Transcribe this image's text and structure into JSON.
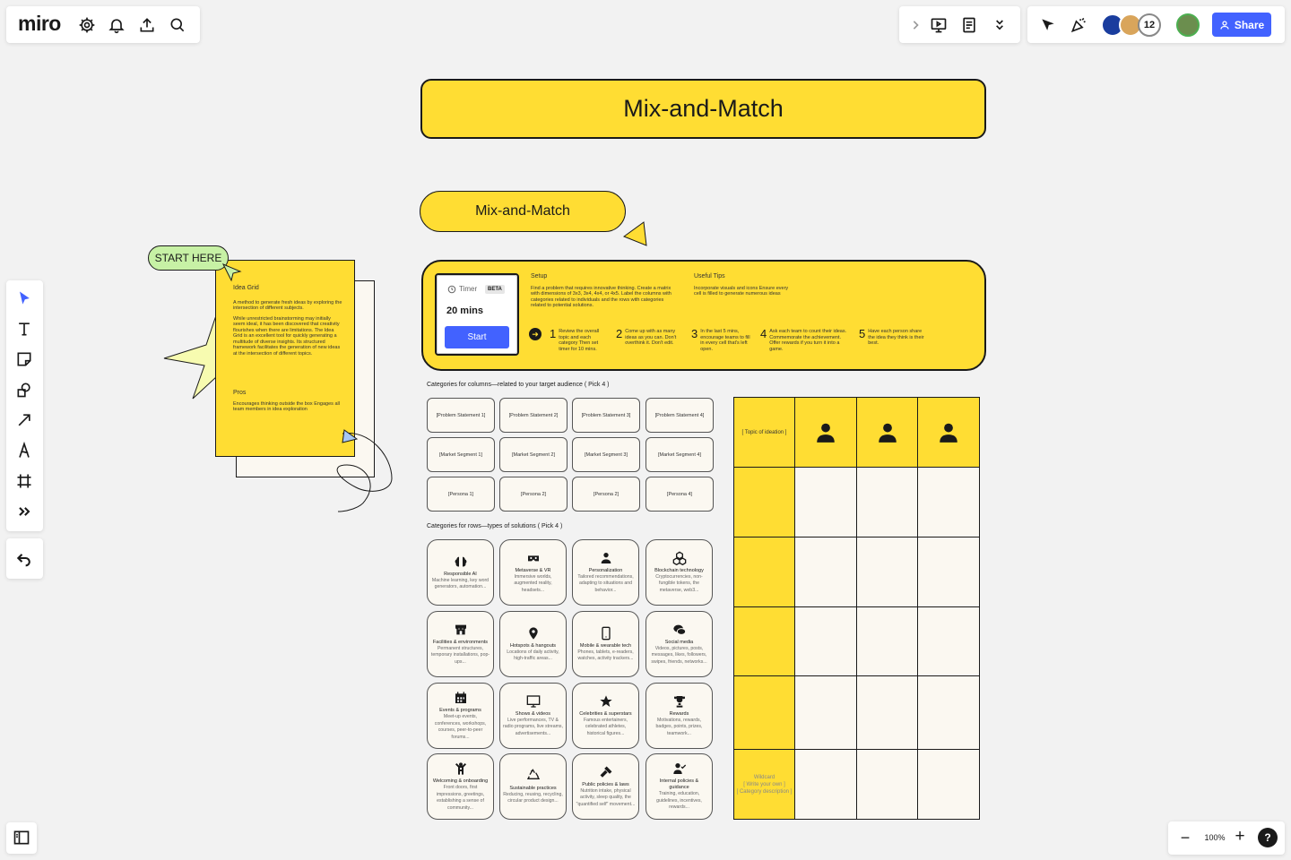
{
  "app": {
    "logo": "miro"
  },
  "top_right": {
    "collaborator_count": "12",
    "share_label": "Share"
  },
  "board": {
    "title": "Mix-and-Match",
    "subtitle": "Mix-and-Match",
    "start_here": "START HERE",
    "idea_card": {
      "heading": "Idea Grid",
      "p1": "A method to generate fresh ideas by exploring the intersection of different subjects.",
      "p2": "While unrestricted brainstorming may initially seem ideal, it has been discovered that creativity flourishes when there are limitations. The Idea Grid is an excellent tool for quickly generating a multitude of diverse insights. Its structured framework facilitates the generation of new ideas at the intersection of different topics.",
      "pros_heading": "Pros",
      "pros_text": "Encourages thinking outside the box Engages all team members in idea exploration"
    },
    "timer": {
      "label": "Timer",
      "badge": "BETA",
      "value": "20 mins",
      "start": "Start"
    },
    "setup": {
      "heading": "Setup",
      "text": "Find a problem that requires innovative thinking. Create a matrix with dimensions of 3x3, 3x4, 4x4, or 4x5. Label the columns with categories related to individuals and the rows with categories related to potential solutions."
    },
    "tips": {
      "heading": "Useful Tips",
      "text": "Incorporate visuals and icons Ensure every cell is filled to generate numerous ideas"
    },
    "steps": [
      {
        "n": "1",
        "text": "Review the overall topic and each category Then set timer for 10 mins."
      },
      {
        "n": "2",
        "text": "Come up with as many ideas as you can. Don't overthink it. Don't edit."
      },
      {
        "n": "3",
        "text": "In the last 5 mins, encourage teams to fill in every cell that's left open."
      },
      {
        "n": "4",
        "text": "Ask each team to count their ideas. Commemorate the achievement. Offer rewards if you turn it into a game."
      },
      {
        "n": "5",
        "text": "Have each person share the idea they think is their best."
      }
    ],
    "columns_heading": "Categories for columns—related to your target audience ( Pick 4 )",
    "column_cards": [
      [
        "[Problem Statement 1]",
        "[Problem Statement 2]",
        "[Problem Statement 3]",
        "[Problem Statement 4]"
      ],
      [
        "[Market Segment 1]",
        "[Market Segment 2]",
        "[Market Segment 3]",
        "[Market Segment 4]"
      ],
      [
        "[Persona 1]",
        "[Persona 2]",
        "[Persona 2]",
        "[Persona 4]"
      ]
    ],
    "rows_heading": "Categories for rows—types of solutions ( Pick 4 )",
    "solutions": [
      {
        "title": "Responsible AI",
        "desc": "Machine learning, key word generators, automation...",
        "icon": "brain-icon"
      },
      {
        "title": "Metaverse & VR",
        "desc": "Immersive worlds, augmented reality, headsets...",
        "icon": "vr-headset-icon"
      },
      {
        "title": "Personalization",
        "desc": "Tailored recommendations, adapting to situations and behavior...",
        "icon": "person-icon"
      },
      {
        "title": "Blockchain technology",
        "desc": "Cryptocurrencies, non-fungible tokens, the metaverse, web3...",
        "icon": "blocks-icon"
      },
      {
        "title": "Facilities & environments",
        "desc": "Permanent structures, temporary installations, pop-ups...",
        "icon": "storefront-icon"
      },
      {
        "title": "Hotspots & hangouts",
        "desc": "Locations of daily activity, high-traffic areas...",
        "icon": "location-pin-icon"
      },
      {
        "title": "Mobile & wearable tech",
        "desc": "Phones, tablets, e-readers, watches, activity trackers...",
        "icon": "phone-icon"
      },
      {
        "title": "Social media",
        "desc": "Videos, pictures, posts, messages, likes, followers, swipes, friends, networks...",
        "icon": "chat-icon"
      },
      {
        "title": "Events & programs",
        "desc": "Meet-up events, conferences, workshops, courses, peer-to-peer forums...",
        "icon": "calendar-icon"
      },
      {
        "title": "Shows & videos",
        "desc": "Live performances, TV & radio programs, live streams, advertisements...",
        "icon": "monitor-icon"
      },
      {
        "title": "Celebrities & superstars",
        "desc": "Famous entertainers, celebrated athletes, historical figures...",
        "icon": "star-icon"
      },
      {
        "title": "Rewards",
        "desc": "Motivations, rewards, badges, points, prizes, teamwork...",
        "icon": "trophy-icon"
      },
      {
        "title": "Welcoming & onboarding",
        "desc": "Front doors, first impressions, greetings, establishing a sense of community...",
        "icon": "welcome-person-icon"
      },
      {
        "title": "Sustainable practices",
        "desc": "Reducing, reusing, recycling, circular product design...",
        "icon": "recycle-icon"
      },
      {
        "title": "Public policies & laws",
        "desc": "Nutrition intake, physical activity, sleep quality, the \"quantified self\" movement...",
        "icon": "gavel-icon"
      },
      {
        "title": "Internal policies & guidance",
        "desc": "Training, education, guidelines, incentives, rewards...",
        "icon": "person-check-icon"
      }
    ],
    "matrix": {
      "topic_label": "[ Topic of ideation ]",
      "wildcard": [
        "Wildcard",
        "[ Write your own ]",
        "[ Category description ]"
      ],
      "colors": {
        "header": "#ffdd33",
        "cell": "#fbf8f1"
      }
    }
  },
  "zoom": {
    "level": "100%"
  }
}
